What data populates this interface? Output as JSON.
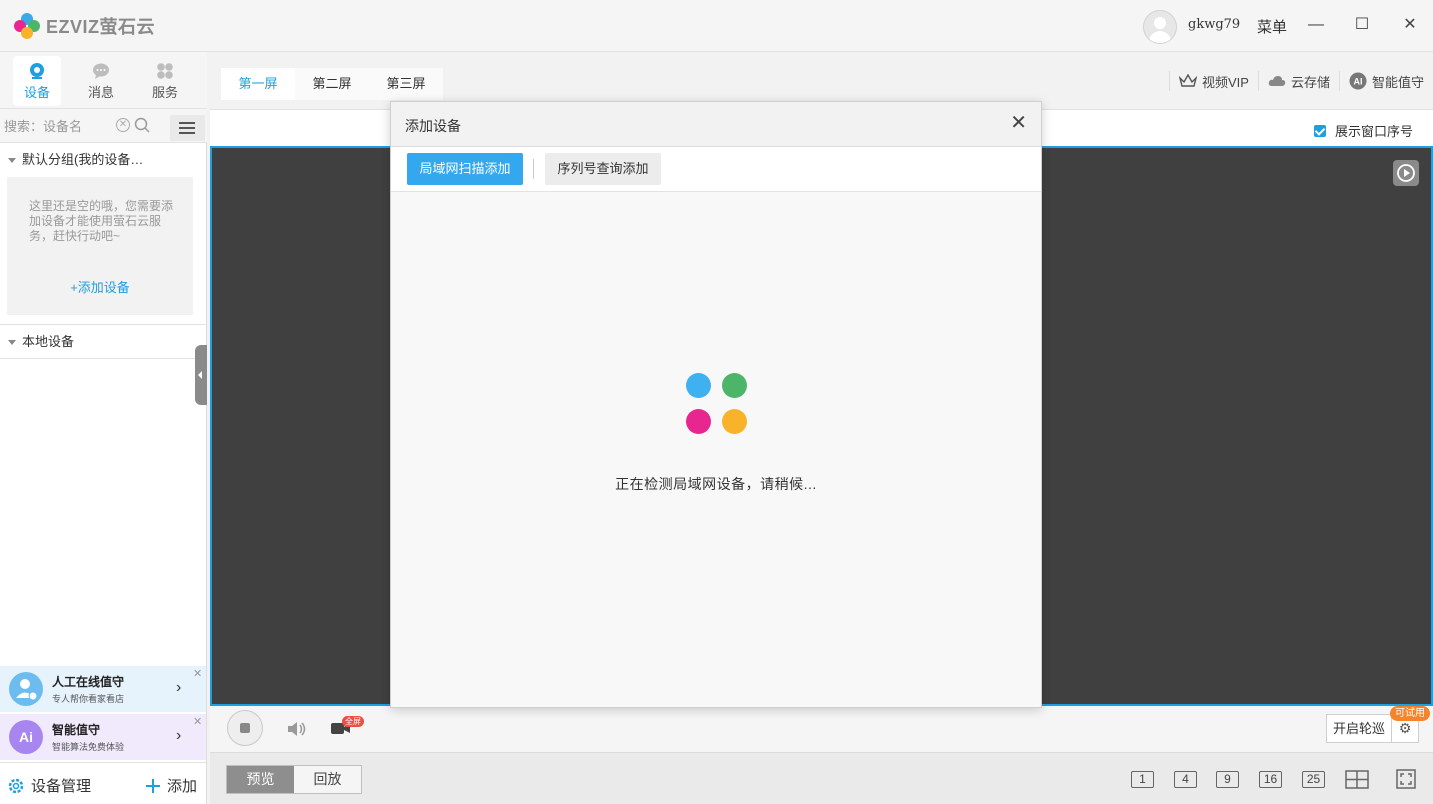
{
  "app": {
    "brand": "EZVIZ萤石云"
  },
  "titlebar": {
    "username": "gkwg79",
    "menu_label": "菜单",
    "minimize": "—",
    "maximize": "☐",
    "close": "✕"
  },
  "sidebar": {
    "tabs": [
      {
        "label": "设备",
        "active": true
      },
      {
        "label": "消息",
        "active": false
      },
      {
        "label": "服务",
        "active": false
      }
    ],
    "search_placeholder": "搜索：设备名",
    "groups": {
      "default_group": "默认分组(我的设备…",
      "empty_text": "这里还是空的哦，您需要添加设备才能使用萤石云服务，赶快行动吧~",
      "add_device_link": "+添加设备",
      "local_devices": "本地设备"
    },
    "promos": [
      {
        "title": "人工在线值守",
        "subtitle": "专人帮你看家看店"
      },
      {
        "title": "智能值守",
        "subtitle": "智能算法免费体验"
      }
    ],
    "bottom": {
      "manage_label": "设备管理",
      "add_label": "添加"
    }
  },
  "main": {
    "screen_tabs": [
      {
        "label": "第一屏",
        "active": true
      },
      {
        "label": "第二屏",
        "active": false
      },
      {
        "label": "第三屏",
        "active": false
      }
    ],
    "top_right": {
      "vip": "视频VIP",
      "cloud": "云存储",
      "ai": "智能值守"
    },
    "show_window_index": {
      "label": "展示窗口序号",
      "checked": true
    },
    "controls": {
      "fullscreen_badge": "全屏",
      "patrol_label": "开启轮巡",
      "trial_badge": "可试用"
    },
    "modes": [
      {
        "label": "预览",
        "active": true
      },
      {
        "label": "回放",
        "active": false
      }
    ],
    "layouts": [
      "1",
      "4",
      "9",
      "16",
      "25"
    ]
  },
  "dialog": {
    "title": "添加设备",
    "tabs": {
      "lan": "局域网扫描添加",
      "serial": "序列号查询添加"
    },
    "status": "正在检测局域网设备，请稍候..."
  },
  "colors": {
    "accent": "#1e9fe0",
    "dot_blue": "#3fb0f0",
    "dot_green": "#4db56a",
    "dot_pink": "#e8268f",
    "dot_orange": "#f9b32b",
    "video_bg": "#404040"
  }
}
